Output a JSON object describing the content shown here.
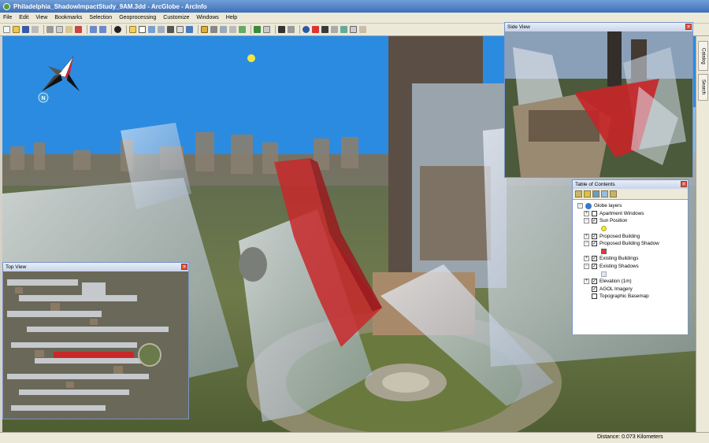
{
  "window": {
    "title": "Philadelphia_ShadowImpactStudy_9AM.3dd - ArcGlobe - ArcInfo"
  },
  "menu": [
    "File",
    "Edit",
    "View",
    "Bookmarks",
    "Selection",
    "Geoprocessing",
    "Customize",
    "Windows",
    "Help"
  ],
  "side_tabs": {
    "catalog": "Catalog",
    "search": "Search"
  },
  "panels": {
    "top_view": "Top View",
    "side_view": "Side View",
    "toc": "Table of Contents"
  },
  "compass_letter": "N",
  "toc": {
    "root": "Globe layers",
    "rows": [
      {
        "label": "Apartment Windows",
        "checked": false
      },
      {
        "label": "Sun Position",
        "checked": true
      },
      {
        "label": "Proposed Building",
        "checked": true
      },
      {
        "label": "Proposed Building Shadow",
        "checked": true
      },
      {
        "label": "Existing Buildings",
        "checked": true
      },
      {
        "label": "Existing Shadows",
        "checked": true
      },
      {
        "label": "Elevation (1m)",
        "checked": true
      },
      {
        "label": "AGOL Imagery",
        "checked": true
      },
      {
        "label": "Topographic Basemap",
        "checked": false
      }
    ],
    "swatches": {
      "sun": "#f2e640",
      "shadow": "#d83a3a",
      "existing_shadows": "#dde6f2"
    }
  },
  "status": {
    "distance": "Distance:  0.073 Kilometers"
  },
  "colors": {
    "sky": "#2b8be0",
    "shadow_red": "#c8282a",
    "ground_green": "#6a7a3a",
    "sun": "#f2e640"
  }
}
